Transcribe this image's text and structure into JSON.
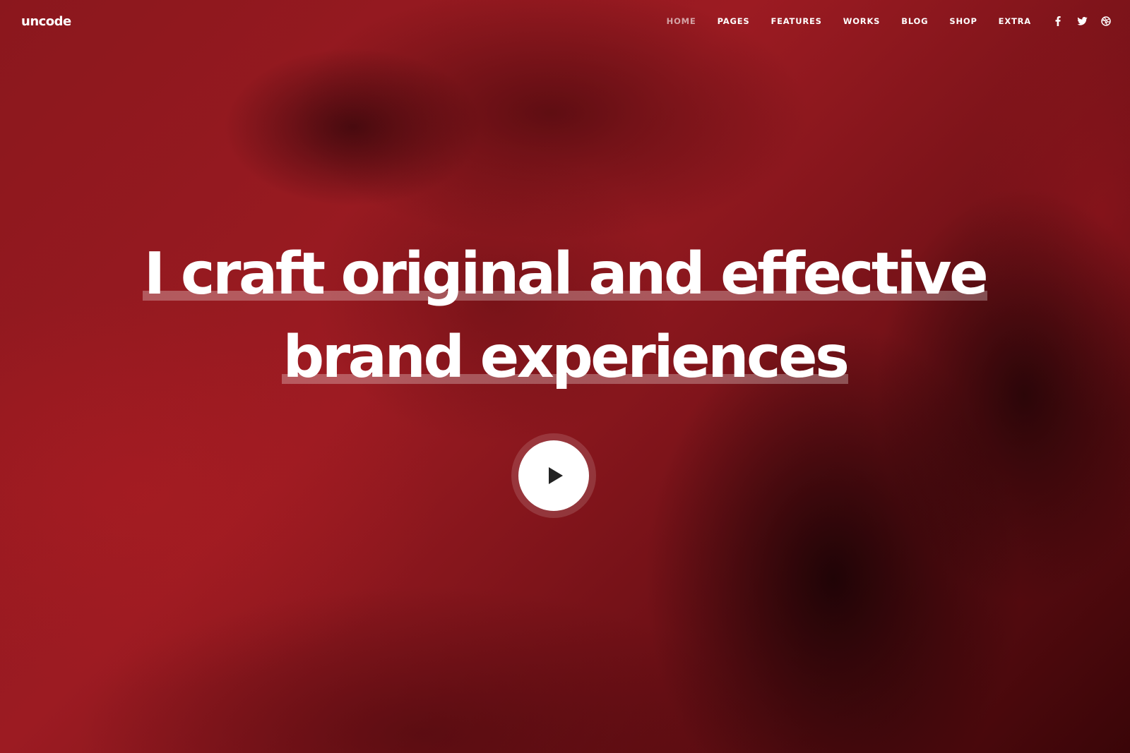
{
  "header": {
    "logo": "uncode",
    "nav": [
      {
        "label": "HOME",
        "active": true
      },
      {
        "label": "PAGES",
        "active": false
      },
      {
        "label": "FEATURES",
        "active": false
      },
      {
        "label": "WORKS",
        "active": false
      },
      {
        "label": "BLOG",
        "active": false
      },
      {
        "label": "SHOP",
        "active": false
      },
      {
        "label": "EXTRA",
        "active": false
      }
    ],
    "social": [
      "facebook-icon",
      "twitter-icon",
      "dribbble-icon"
    ]
  },
  "hero": {
    "headline_line1": "I craft original and effective",
    "headline_line2": "brand experiences",
    "play_icon": "play-icon"
  },
  "colors": {
    "background": "#8f1a20",
    "text": "#ffffff",
    "play_icon": "#222222"
  }
}
